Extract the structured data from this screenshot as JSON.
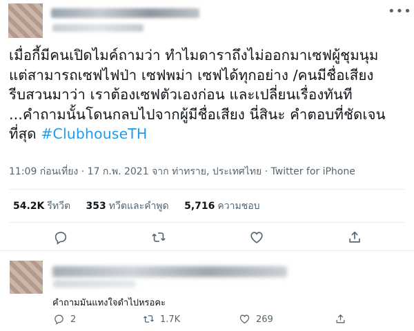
{
  "tweet": {
    "lines": [
      "เมื่อกี้มีคนเปิดไมค์ถามว่า ทำไมดาราถึงไม่ออกมาเซฟผู้ชุมนุม",
      "แต่สามารถเซฟไฟป่า เซฟพม่า เซฟได้ทุกอย่าง /คนมีชื่อเสียง",
      "รีบสวนมาว่า เราต้องเซฟตัวเองก่อน และเปลี่ยนเรื่องทันที",
      "...คำถามนั้นโดนกลบไปจากผู้มีชื่อเสียง นี่สินะ คำตอบที่ชัดเจน"
    ],
    "last_line_text": "ที่สุด",
    "hashtag": "#ClubhouseTH",
    "time": "11:09 ก่อนเที่ยง",
    "date": "17 ก.พ. 2021",
    "location": "จาก ท่าทราย, ประเทศไทย",
    "source": "Twitter for iPhone",
    "more_icon": "more-dots-icon"
  },
  "stats": {
    "retweets_count": "54.2K",
    "retweets_label": "รีทวีต",
    "quotes_count": "353",
    "quotes_label": "ทวีตและคำพูด",
    "likes_count": "5,716",
    "likes_label": "ความชอบ"
  },
  "actions": [
    "reply-icon",
    "retweet-icon",
    "like-icon",
    "share-icon"
  ],
  "reply": {
    "text": "คำถามมันแทงใจดำไปหรอคะ",
    "reply_count": "2",
    "retweet_count": "1.7K",
    "like_count": "269"
  },
  "colors": {
    "accent": "#1d9bf0",
    "secondary_text": "#536471",
    "divider": "#ebeef0"
  }
}
